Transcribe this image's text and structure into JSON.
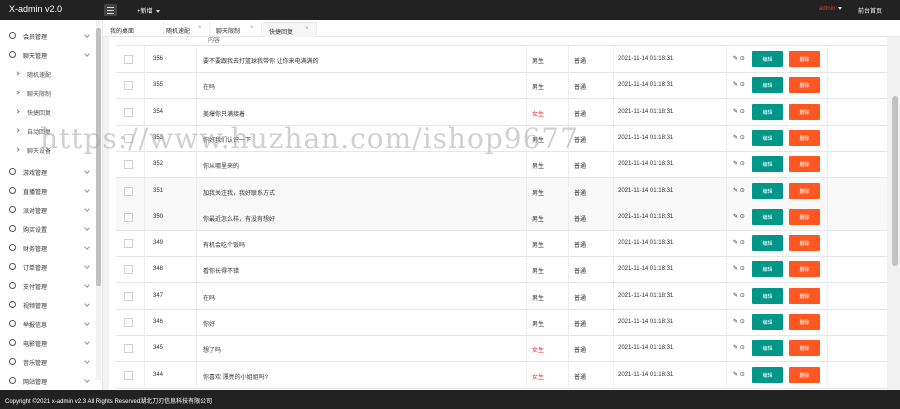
{
  "app": {
    "title": "X-admin v2.0",
    "add_label": "+新增",
    "user": "admin",
    "home_link": "前台首页"
  },
  "colors": {
    "topbar": "#222222",
    "edit_button": "#009688",
    "delete_button": "#ff5722",
    "female_text": "#e33333"
  },
  "sidebar": {
    "items": [
      {
        "label": "会员管理",
        "icon": "user-icon",
        "type": "section"
      },
      {
        "label": "聊天管理",
        "icon": "user-icon",
        "type": "section"
      },
      {
        "label": "随机速配",
        "type": "sub"
      },
      {
        "label": "聊天限制",
        "type": "sub"
      },
      {
        "label": "快捷回复",
        "type": "sub"
      },
      {
        "label": "自动回复",
        "type": "sub"
      },
      {
        "label": "聊天设备",
        "type": "sub"
      },
      {
        "label": "游戏管理",
        "icon": "gamepad-icon",
        "type": "section"
      },
      {
        "label": "直播管理",
        "icon": "headset-icon",
        "type": "section"
      },
      {
        "label": "派对管理",
        "icon": "headset-icon",
        "type": "section"
      },
      {
        "label": "购买设置",
        "icon": "headset-icon",
        "type": "section"
      },
      {
        "label": "财务管理",
        "icon": "headset-icon",
        "type": "section"
      },
      {
        "label": "订单管理",
        "icon": "order-icon",
        "type": "section"
      },
      {
        "label": "支付管理",
        "icon": "order-icon",
        "type": "section"
      },
      {
        "label": "视频管理",
        "icon": "order-icon",
        "type": "section"
      },
      {
        "label": "举报信息",
        "icon": "order-icon",
        "type": "section"
      },
      {
        "label": "电影管理",
        "icon": "order-icon",
        "type": "section"
      },
      {
        "label": "音乐管理",
        "icon": "order-icon",
        "type": "section"
      },
      {
        "label": "网站管理",
        "icon": "order-icon",
        "type": "section"
      }
    ]
  },
  "tabs": [
    {
      "label": "我的桌面",
      "active": false
    },
    {
      "label": "随机速配",
      "active": false
    },
    {
      "label": "聊天限制",
      "active": false
    },
    {
      "label": "快捷回复",
      "active": true
    }
  ],
  "table": {
    "rows": [
      {
        "id": "356",
        "content": "要不要跟我去打篮球我带你 让你来电满满的",
        "gender": "男生",
        "level": "普通",
        "time": "2021-11-14 01:18:31"
      },
      {
        "id": "355",
        "content": "在吗",
        "gender": "男生",
        "level": "普通",
        "time": "2021-11-14 01:18:31"
      },
      {
        "id": "354",
        "content": "美爆你只满接着",
        "gender": "女生",
        "level": "普通",
        "time": "2021-11-14 01:18:31"
      },
      {
        "id": "353",
        "content": "你好我们认识一下",
        "gender": "男生",
        "level": "普通",
        "time": "2021-11-14 01:18:31"
      },
      {
        "id": "352",
        "content": "你从哪里来的",
        "gender": "男生",
        "level": "普通",
        "time": "2021-11-14 01:18:31"
      },
      {
        "id": "351",
        "content": "加我关注我，我好联系方式",
        "gender": "男生",
        "level": "普通",
        "time": "2021-11-14 01:18:31"
      },
      {
        "id": "350",
        "content": "你最近怎么样，有没有想好",
        "gender": "男生",
        "level": "普通",
        "time": "2021-11-14 01:18:31"
      },
      {
        "id": "349",
        "content": "有机会吃个饭吗",
        "gender": "男生",
        "level": "普通",
        "time": "2021-11-14 01:18:31"
      },
      {
        "id": "348",
        "content": "看你长得不错",
        "gender": "男生",
        "level": "普通",
        "time": "2021-11-14 01:18:31"
      },
      {
        "id": "347",
        "content": "在吗",
        "gender": "男生",
        "level": "普通",
        "time": "2021-11-14 01:18:31"
      },
      {
        "id": "346",
        "content": "你好",
        "gender": "男生",
        "level": "普通",
        "time": "2021-11-14 01:18:31"
      },
      {
        "id": "345",
        "content": "想了吗",
        "gender": "女生",
        "level": "普通",
        "time": "2021-11-14 01:18:31"
      },
      {
        "id": "344",
        "content": "你喜欢 漂亮的小姐姐吗?",
        "gender": "女生",
        "level": "普通",
        "time": "2021-11-14 01:18:31"
      }
    ],
    "edit_label": "编辑",
    "delete_label": "删除"
  },
  "footer": {
    "text": "Copyright ©2021 x-admin v2.3 All Rights Reserved湖北刀刃信息科技有限公司"
  },
  "watermark": "https://www.huzhan.com/ishop9677"
}
